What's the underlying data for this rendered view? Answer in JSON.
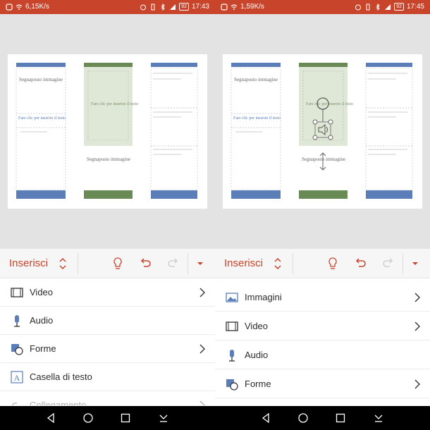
{
  "left": {
    "status": {
      "speed": "6,15K/s",
      "battery": "92",
      "time": "17:43"
    },
    "ribbon": {
      "tab_name": "Inserisci"
    },
    "menu_items": [
      {
        "label": "Video",
        "icon": "film-icon",
        "chevron": true
      },
      {
        "label": "Audio",
        "icon": "microphone-icon",
        "chevron": false
      },
      {
        "label": "Forme",
        "icon": "shapes-icon",
        "chevron": true
      },
      {
        "label": "Casella di testo",
        "icon": "text-box-icon",
        "chevron": false
      },
      {
        "label": "Collegamento",
        "icon": "link-icon",
        "chevron": true
      }
    ],
    "slide": {
      "placeholder_image_1": "Segnaposto immagine",
      "tap_to_insert": "Fare clic per inserire il testo",
      "placeholder_image_2": "Segnaposto immagine",
      "green_text": "Fare clic per inserire il testo"
    }
  },
  "right": {
    "status": {
      "speed": "1,59K/s",
      "battery": "92",
      "time": "17:45"
    },
    "ribbon": {
      "tab_name": "Inserisci"
    },
    "menu_items": [
      {
        "label": "Immagini",
        "icon": "image-icon",
        "chevron": true
      },
      {
        "label": "Video",
        "icon": "film-icon",
        "chevron": true
      },
      {
        "label": "Audio",
        "icon": "microphone-icon",
        "chevron": false
      },
      {
        "label": "Forme",
        "icon": "shapes-icon",
        "chevron": true
      }
    ],
    "slide": {
      "placeholder_image_1": "Segnaposto immagine",
      "tap_to_insert": "Fare clic per inserire il testo",
      "placeholder_image_2": "Segnaposto immagine",
      "green_text": "Fare clic per inserire il testo"
    }
  },
  "colors": {
    "accent": "#c8442a",
    "slide_blue": "#5b7db8",
    "slide_green": "#6a8a55",
    "green_fill": "#dfe7d6"
  }
}
